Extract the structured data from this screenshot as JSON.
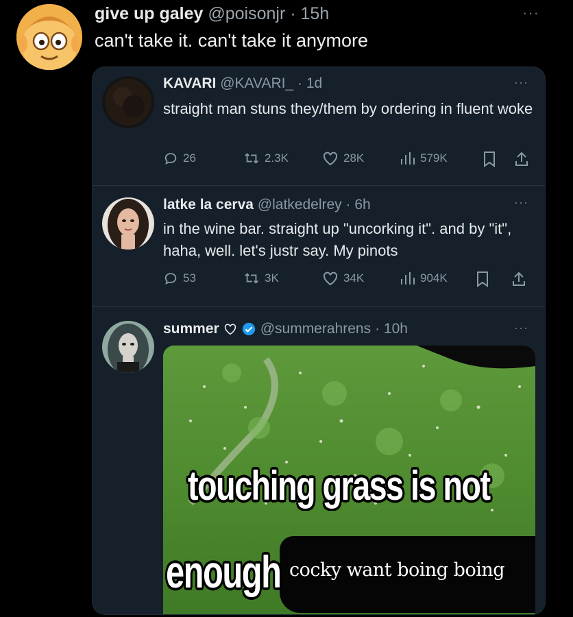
{
  "outer_tweet": {
    "display_name": "give up galey",
    "handle": "@poisonjr",
    "time": "· 15h",
    "text": "can't take it. can't take it anymore",
    "more": "···"
  },
  "tweets": [
    {
      "display_name": "KAVARI",
      "handle": "@KAVARI_",
      "time": "· 1d",
      "text": "straight man stuns they/them by ordering in fluent woke",
      "more": "···",
      "replies": "26",
      "retweets": "2.3K",
      "likes": "28K",
      "views": "579K"
    },
    {
      "display_name": "latke la cerva",
      "handle": "@latkedelrey",
      "time": "· 6h",
      "text": "in the wine bar. straight up \"uncorking it\". and by \"it\", haha, well. let's justr say. My pinots",
      "more": "···",
      "replies": "53",
      "retweets": "3K",
      "likes": "34K",
      "views": "904K"
    },
    {
      "display_name": "summer",
      "handle": "@summerahrens",
      "time": "· 10h",
      "more": "···",
      "verified": true,
      "media": {
        "line1": "touching grass is not",
        "line2": "enough",
        "caption": "cocky want boing boing"
      }
    }
  ],
  "icons": {
    "reply": "reply-icon",
    "retweet": "retweet-icon",
    "like": "heart-icon",
    "views": "views-icon",
    "bookmark": "bookmark-icon",
    "share": "share-icon"
  },
  "colors": {
    "background": "#000000",
    "card": "#15202b",
    "muted": "#8b98a5",
    "verified": "#1d9bf0"
  }
}
